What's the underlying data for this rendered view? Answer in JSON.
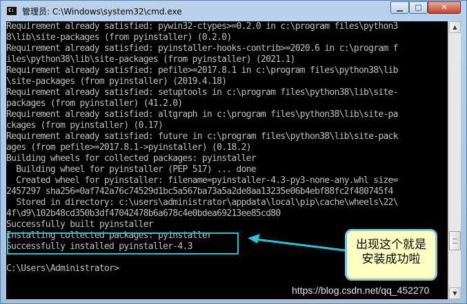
{
  "window": {
    "title": "管理员: C:\\Windows\\system32\\cmd.exe",
    "minimize_glyph": "▁",
    "maximize_glyph": "□",
    "close_glyph": "✕"
  },
  "console_lines": [
    "Requirement already satisfied: pywin32-ctypes>=0.2.0 in c:\\program files\\python3",
    "8\\lib\\site-packages (from pyinstaller) (0.2.0)",
    "Requirement already satisfied: pyinstaller-hooks-contrib>=2020.6 in c:\\program f",
    "iles\\python38\\lib\\site-packages (from pyinstaller) (2021.1)",
    "Requirement already satisfied: pefile>=2017.8.1 in c:\\program files\\python38\\lib",
    "\\site-packages (from pyinstaller) (2019.4.18)",
    "Requirement already satisfied: setuptools in c:\\program files\\python38\\lib\\site-",
    "packages (from pyinstaller) (41.2.0)",
    "Requirement already satisfied: altgraph in c:\\program files\\python38\\lib\\site-pa",
    "ckages (from pyinstaller) (0.17)",
    "Requirement already satisfied: future in c:\\program files\\python38\\lib\\site-pack",
    "ages (from pefile>=2017.8.1->pyinstaller) (0.18.2)",
    "Building wheels for collected packages: pyinstaller",
    "  Building wheel for pyinstaller (PEP 517) ... done",
    "  Created wheel for pyinstaller: filename=pyinstaller-4.3-py3-none-any.whl size=",
    "2457297 sha256=0af742a76c74529d1bc5a567ba73a5a2de8aa13235e06b4ebf88fc2f480745f4",
    "  Stored in directory: c:\\users\\administrator\\appdata\\local\\pip\\cache\\wheels\\22\\",
    "4f\\d9\\102b48cd350b3df47042478b6a678c4e0bdea69213ee85cd80",
    "Successfully built pyinstaller",
    "Installing collected packages: pyinstaller",
    "Successfully installed pyinstaller-4.3",
    "",
    "C:\\Users\\Administrator>"
  ],
  "callout": {
    "text": "出现这个就是安装成功啦"
  },
  "watermark": "https://blog.csdn.net/qq_452270",
  "icons": {
    "title_icon": "cmd-icon",
    "scroll_up": "scroll-up-arrow-icon",
    "scroll_down": "scroll-down-arrow-icon"
  },
  "colors": {
    "console_bg": "#000000",
    "console_text": "#c0c0c0",
    "highlight": "#25c6d6",
    "callout_bg": "#ffffc4"
  }
}
